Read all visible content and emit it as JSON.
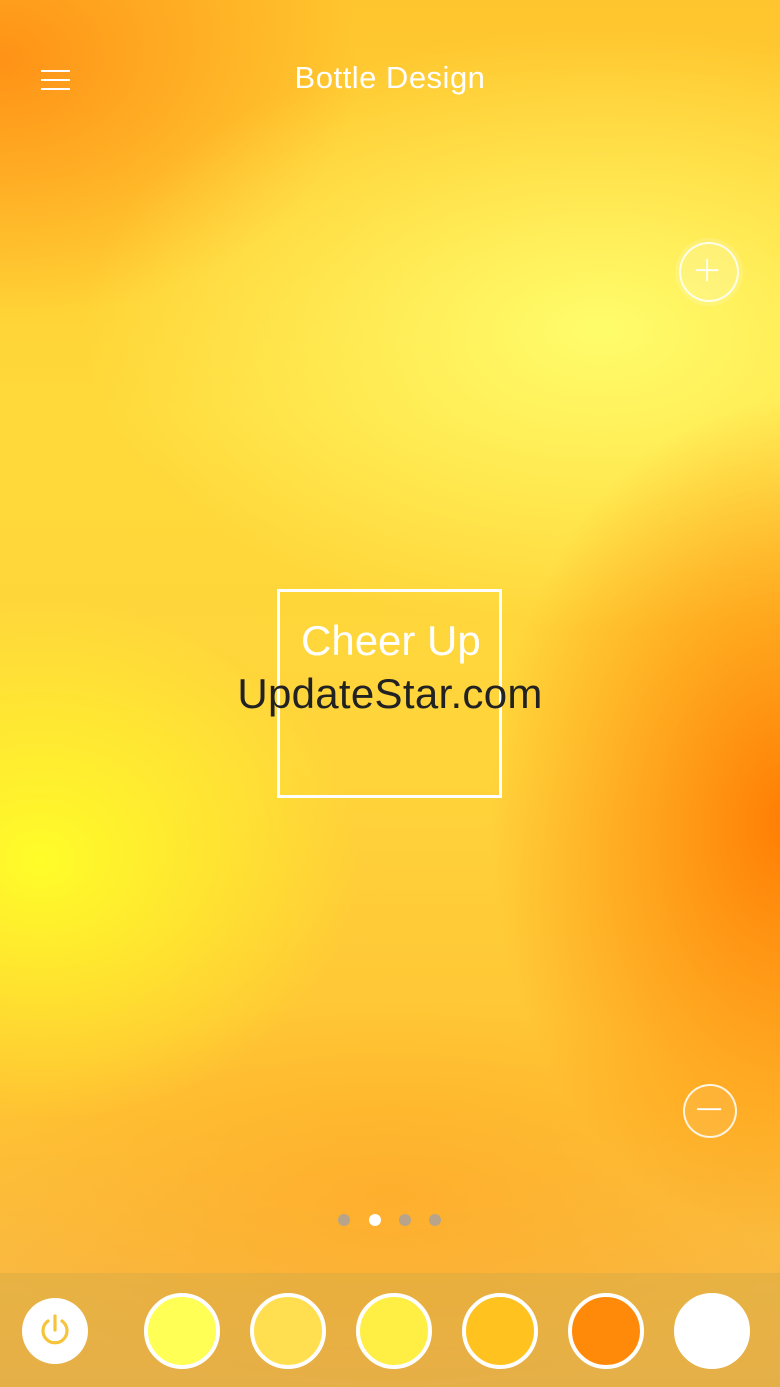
{
  "header": {
    "title": "Bottle Design",
    "menu_icon": "hamburger-menu-icon"
  },
  "controls": {
    "zoom_in_icon": "plus-icon",
    "zoom_out_icon": "minus-icon"
  },
  "bottle_label": {
    "text": "Cheer Up"
  },
  "watermark": {
    "text": "UpdateStar.com"
  },
  "pager": {
    "count": 4,
    "active_index": 1
  },
  "bottom_bar": {
    "power_icon": "power-icon",
    "power_icon_color": "#f5c43a",
    "swatches": [
      {
        "color": "#ffff55"
      },
      {
        "color": "#ffdf4f"
      },
      {
        "color": "#ffef44"
      },
      {
        "color": "#ffc21f"
      },
      {
        "color": "#ff8a0a"
      },
      {
        "color": "#ffffff"
      }
    ]
  }
}
